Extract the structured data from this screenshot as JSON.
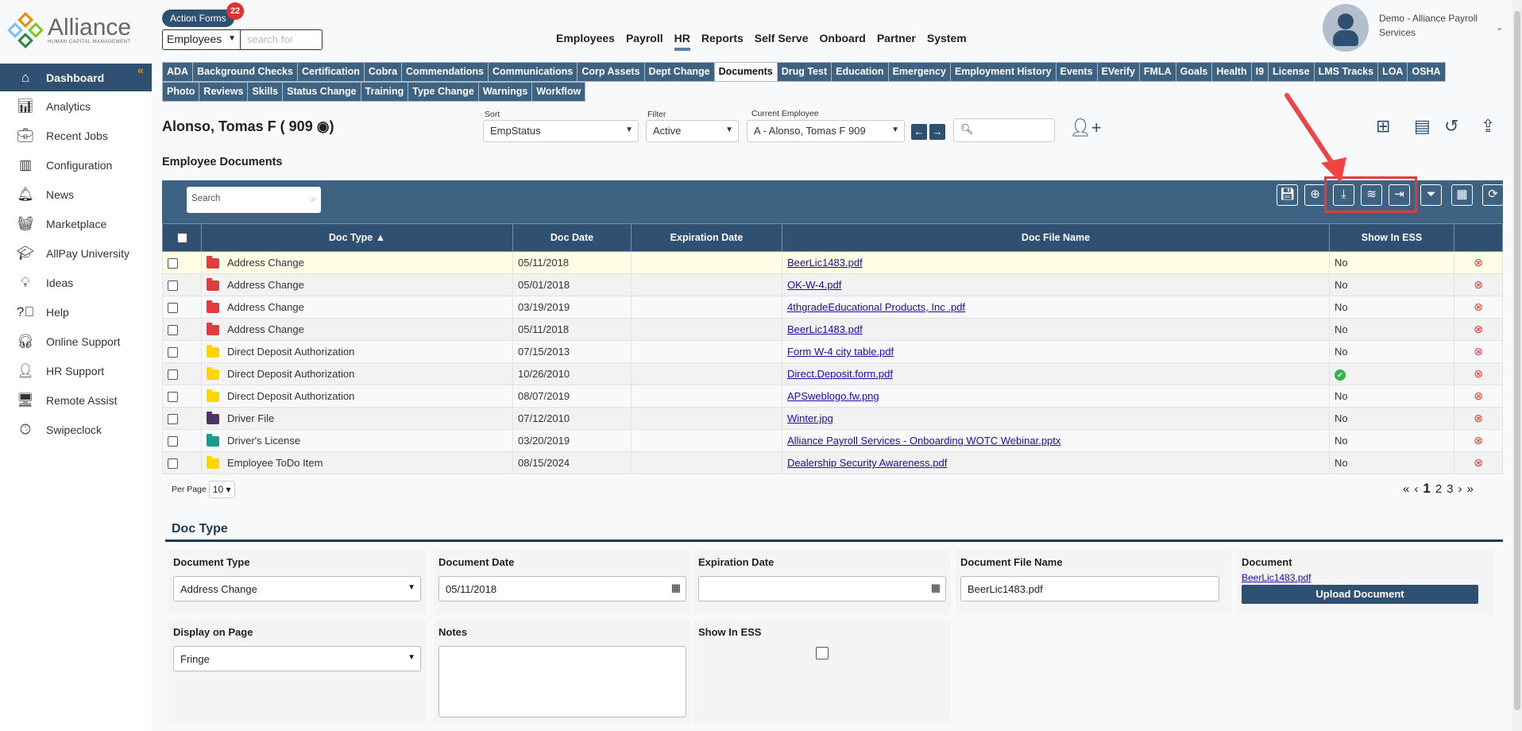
{
  "brand": {
    "name": "Alliance",
    "tagline": "HUMAN CAPITAL MANAGEMENT"
  },
  "header": {
    "action_forms": "Action Forms",
    "action_forms_count": "22",
    "search_scope": "Employees",
    "search_placeholder": "search for",
    "nav": [
      "Employees",
      "Payroll",
      "HR",
      "Reports",
      "Self Serve",
      "Onboard",
      "Partner",
      "System"
    ],
    "active_nav": "HR",
    "user_name": "Demo - Alliance Payroll Services"
  },
  "sidebar": {
    "items": [
      {
        "label": "Dashboard",
        "icon": "home-icon"
      },
      {
        "label": "Analytics",
        "icon": "analytics-icon"
      },
      {
        "label": "Recent Jobs",
        "icon": "briefcase-icon"
      },
      {
        "label": "Configuration",
        "icon": "building-icon"
      },
      {
        "label": "News",
        "icon": "bell-icon"
      },
      {
        "label": "Marketplace",
        "icon": "basket-icon"
      },
      {
        "label": "AllPay University",
        "icon": "graduation-cap-icon"
      },
      {
        "label": "Ideas",
        "icon": "lightbulb-icon"
      },
      {
        "label": "Help",
        "icon": "question-icon"
      },
      {
        "label": "Online Support",
        "icon": "headset-icon"
      },
      {
        "label": "HR Support",
        "icon": "person-icon"
      },
      {
        "label": "Remote Assist",
        "icon": "monitor-icon"
      },
      {
        "label": "Swipeclock",
        "icon": "clock-icon"
      }
    ]
  },
  "tabs": {
    "row1": [
      "ADA",
      "Background Checks",
      "Certification",
      "Cobra",
      "Commendations",
      "Communications",
      "Corp Assets",
      "Dept Change",
      "Documents",
      "Drug Test",
      "Education",
      "Emergency",
      "Employment History",
      "Events",
      "EVerify",
      "FMLA",
      "Goals",
      "Health",
      "I9",
      "License",
      "LMS Tracks",
      "LOA",
      "OSHA"
    ],
    "row2": [
      "Photo",
      "Reviews",
      "Skills",
      "Status Change",
      "Training",
      "Type Change",
      "Warnings",
      "Workflow"
    ],
    "active": "Documents"
  },
  "employee": {
    "title": "Alonso, Tomas F ( 909",
    "sort_label": "Sort",
    "sort_value": "EmpStatus",
    "filter_label": "Filter",
    "filter_value": "Active",
    "current_label": "Current Employee",
    "current_value": "A - Alonso, Tomas F 909"
  },
  "section_title": "Employee Documents",
  "grid": {
    "search_placeholder": "Search",
    "columns": [
      "Doc Type ▲",
      "Doc Date",
      "Expiration Date",
      "Doc File Name",
      "Show In ESS"
    ],
    "rows": [
      {
        "type": "Address Change",
        "color": "#e03e3e",
        "date": "05/11/2018",
        "exp": "",
        "file": "BeerLic1483.pdf",
        "ess": "No"
      },
      {
        "type": "Address Change",
        "color": "#e03e3e",
        "date": "05/01/2018",
        "exp": "",
        "file": "OK-W-4.pdf",
        "ess": "No"
      },
      {
        "type": "Address Change",
        "color": "#e03e3e",
        "date": "03/19/2019",
        "exp": "",
        "file": "4thgradeEducational Products, Inc .pdf",
        "ess": "No"
      },
      {
        "type": "Address Change",
        "color": "#e03e3e",
        "date": "05/11/2018",
        "exp": "",
        "file": "BeerLic1483.pdf",
        "ess": "No"
      },
      {
        "type": "Direct Deposit Authorization",
        "color": "#ffd60a",
        "date": "07/15/2013",
        "exp": "",
        "file": "Form W-4 city table.pdf",
        "ess": "No"
      },
      {
        "type": "Direct Deposit Authorization",
        "color": "#ffd60a",
        "date": "10/26/2010",
        "exp": "",
        "file": "Direct.Deposit.form.pdf",
        "ess": "yes-check"
      },
      {
        "type": "Direct Deposit Authorization",
        "color": "#ffd60a",
        "date": "08/07/2019",
        "exp": "",
        "file": "APSweblogo.fw.png",
        "ess": "No"
      },
      {
        "type": "Driver File",
        "color": "#4a3560",
        "date": "07/12/2010",
        "exp": "",
        "file": "Winter.jpg",
        "ess": "No"
      },
      {
        "type": "Driver's License",
        "color": "#1f9a8a",
        "date": "03/20/2019",
        "exp": "",
        "file": "Alliance Payroll Services - Onboarding WOTC Webinar.pptx",
        "ess": "No"
      },
      {
        "type": "Employee ToDo Item",
        "color": "#ffd60a",
        "date": "08/15/2024",
        "exp": "",
        "file": "Dealership Security Awareness.pdf",
        "ess": "No"
      }
    ],
    "per_page_label": "Per Page",
    "per_page": "10",
    "pages": [
      "1",
      "2",
      "3"
    ],
    "current_page": "1"
  },
  "form": {
    "heading": "Doc Type",
    "document_type_label": "Document Type",
    "document_type": "Address Change",
    "document_date_label": "Document Date",
    "document_date": "05/11/2018",
    "expiration_date_label": "Expiration Date",
    "expiration_date": "",
    "file_name_label": "Document File Name",
    "file_name": "BeerLic1483.pdf",
    "document_label": "Document",
    "document_link": "BeerLic1483.pdf",
    "upload_label": "Upload Document",
    "display_label": "Display on Page",
    "display_value": "Fringe",
    "notes_label": "Notes",
    "notes": "",
    "ess_label": "Show In ESS",
    "ess_checked": false
  },
  "colors": {
    "primary": "#2f5070",
    "toolbar": "#3e6282",
    "highlight": "#e53935"
  }
}
